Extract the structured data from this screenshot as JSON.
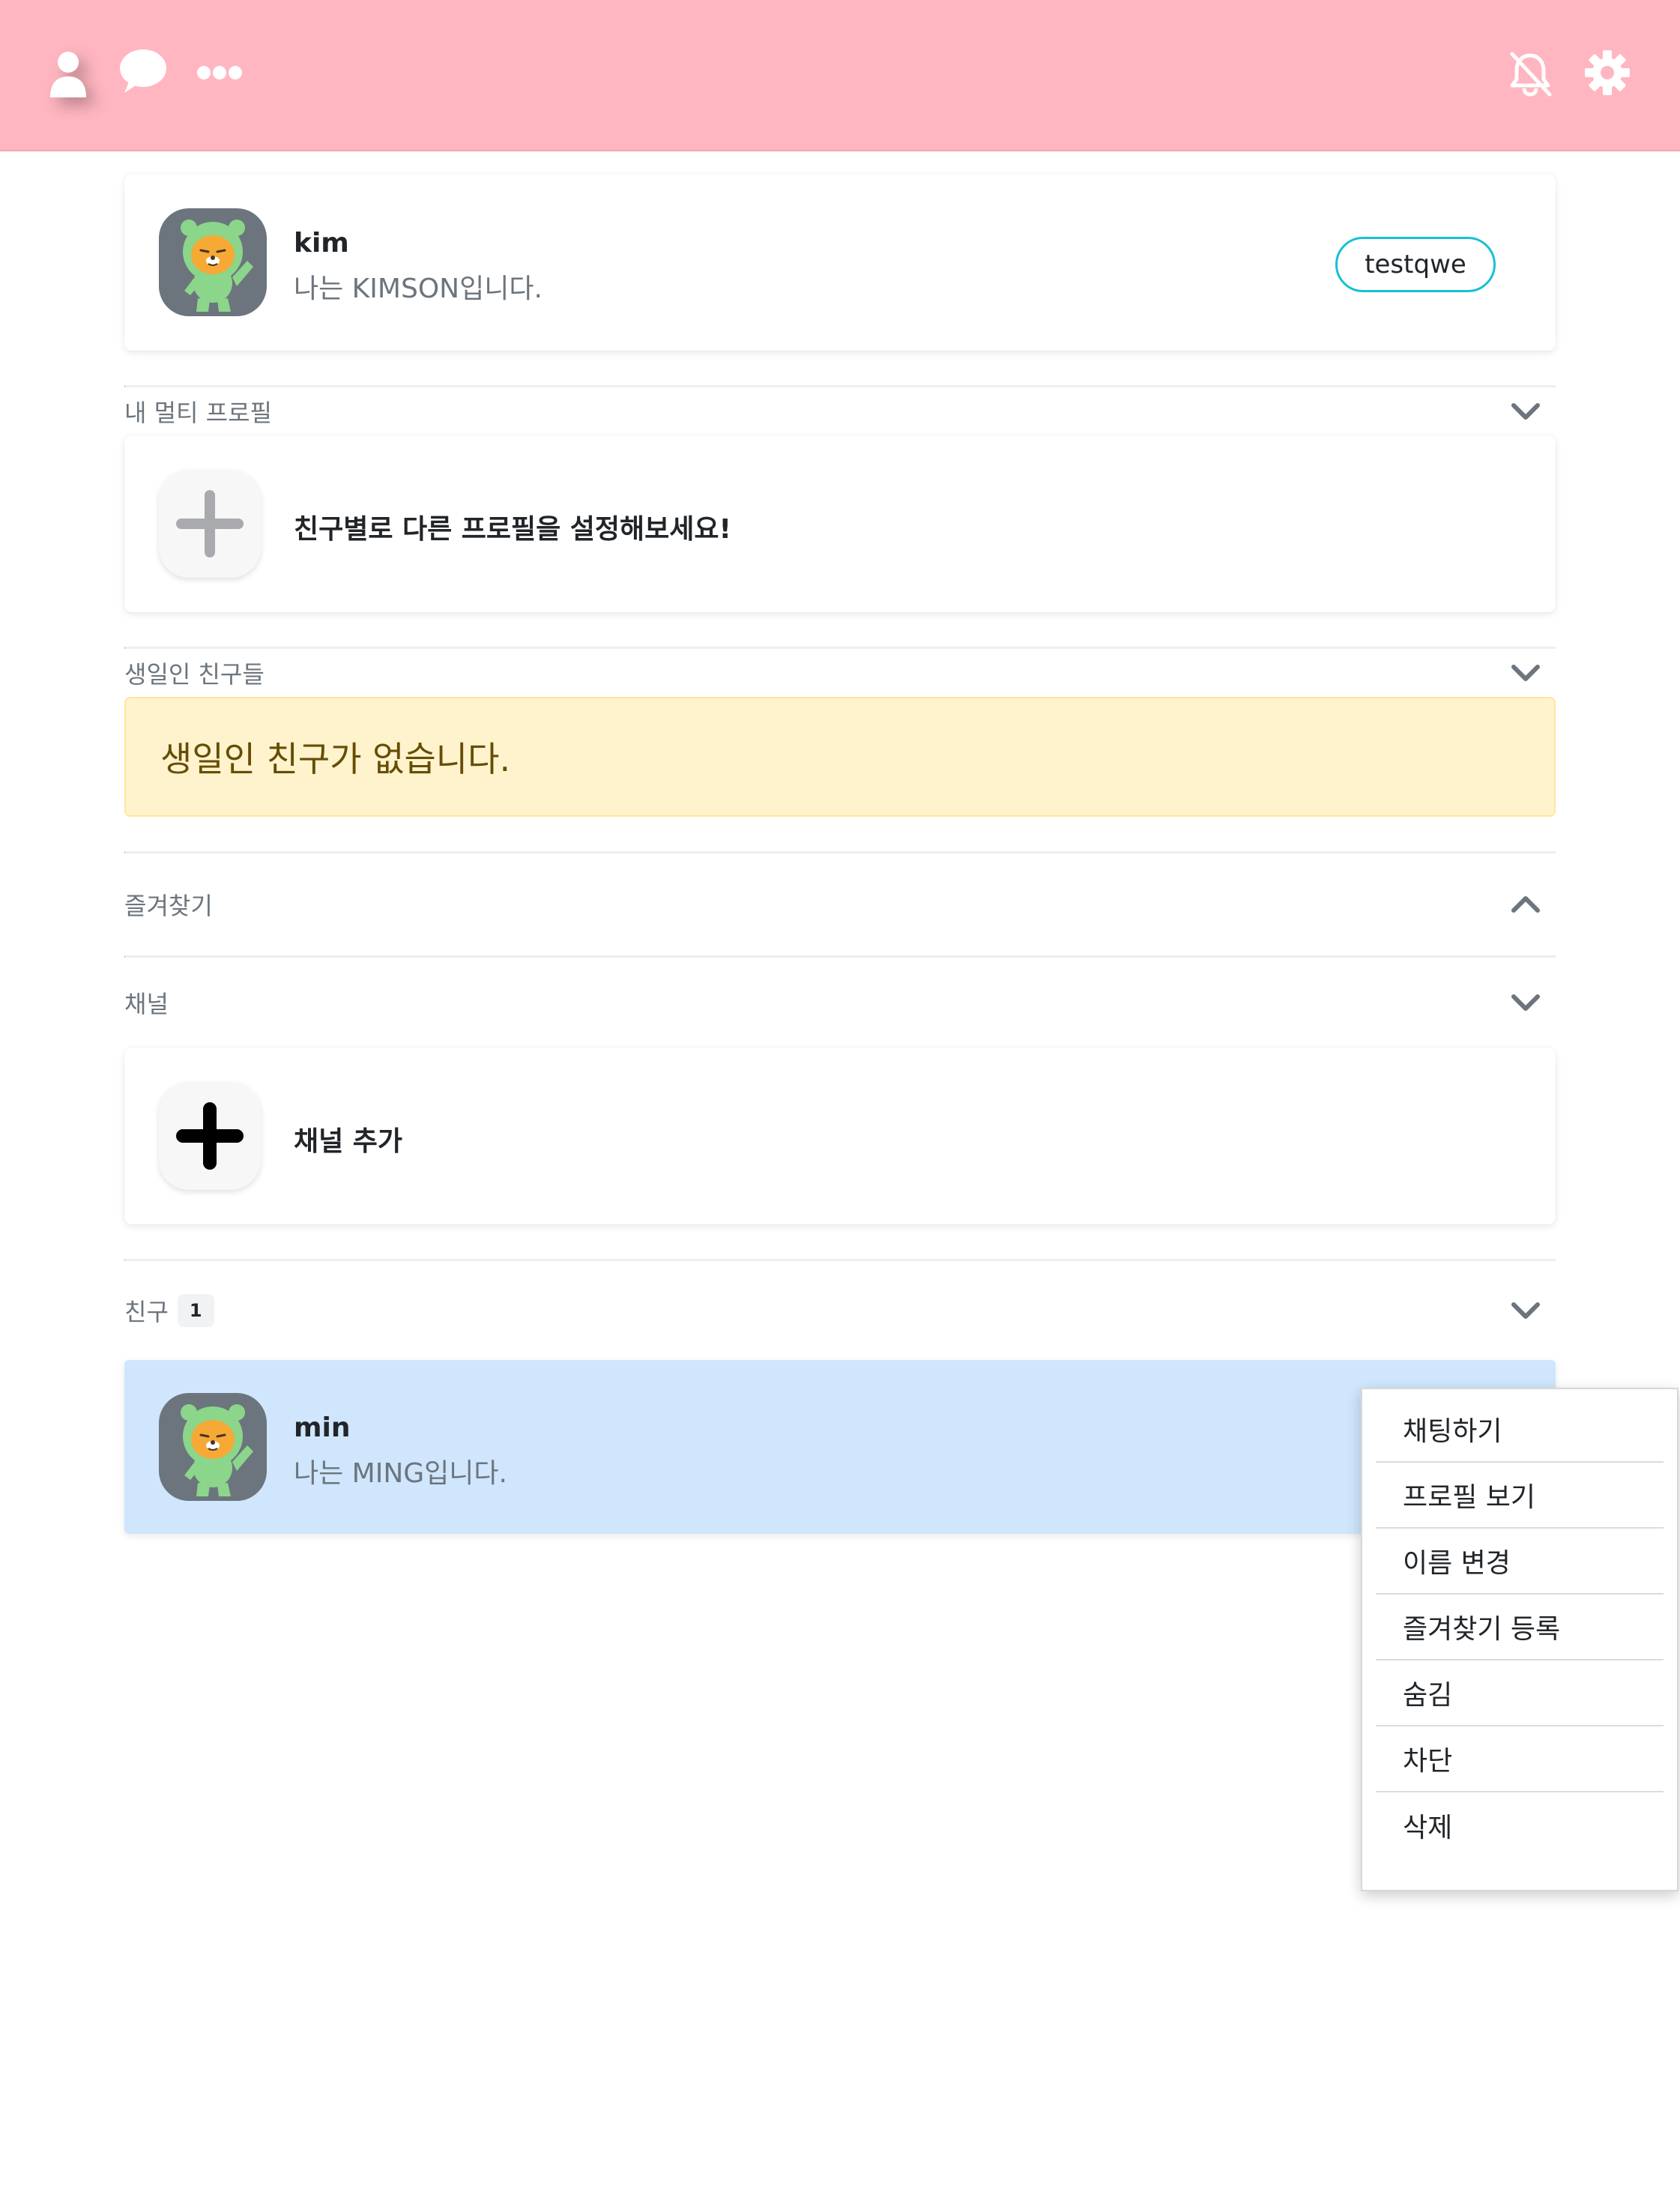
{
  "colors": {
    "topbar_background": "#ffb6c1",
    "pill_border": "#17c1d0",
    "alert_background": "#fff3cd",
    "alert_text": "#664d03",
    "friend_row_highlight": "#cfe6fd"
  },
  "header": {
    "icons_left": [
      "person-icon",
      "chat-bubble-icon",
      "more-dots-icon"
    ],
    "icons_right": [
      "bell-slash-icon",
      "gear-icon"
    ]
  },
  "my_profile": {
    "name": "kim",
    "status": "나는 KIMSON입니다.",
    "button_label": "testqwe"
  },
  "sections": {
    "multi_profile": {
      "title": "내 멀티 프로필",
      "action_text": "친구별로 다른 프로필을 설정해보세요!"
    },
    "birthday": {
      "title": "생일인 친구들",
      "empty_message": "생일인 친구가 없습니다."
    },
    "favorites": {
      "title": "즐겨찾기"
    },
    "channel": {
      "title": "채널",
      "action_text": "채널 추가"
    },
    "friends": {
      "title": "친구",
      "count": "1",
      "items": [
        {
          "name": "min",
          "status": "나는 MING입니다."
        }
      ]
    }
  },
  "context_menu": {
    "items": [
      {
        "label": "채팅하기"
      },
      {
        "label": "프로필 보기"
      },
      {
        "label": "이름 변경"
      },
      {
        "label": "즐겨찾기 등록"
      },
      {
        "label": "숨김"
      },
      {
        "label": "차단"
      },
      {
        "label": "삭제"
      }
    ]
  }
}
